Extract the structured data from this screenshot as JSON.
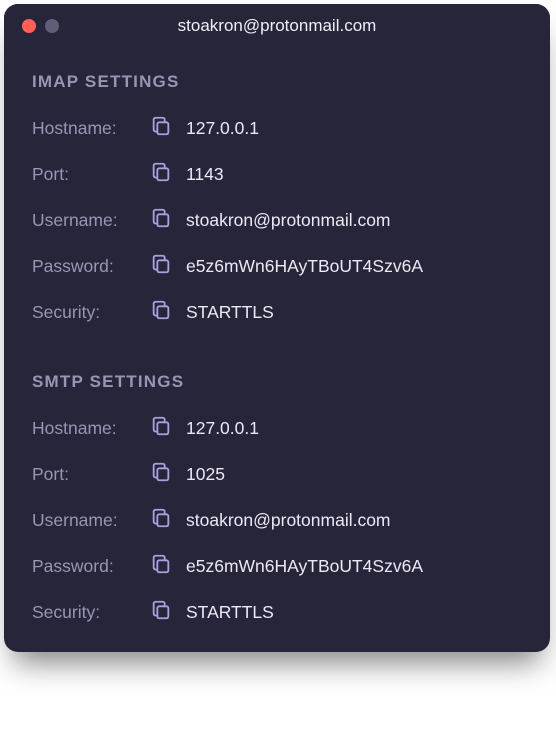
{
  "titlebar": {
    "title": "stoakron@protonmail.com"
  },
  "sections": [
    {
      "heading": "IMAP SETTINGS",
      "rows": [
        {
          "label": "Hostname:",
          "value": "127.0.0.1"
        },
        {
          "label": "Port:",
          "value": "1143"
        },
        {
          "label": "Username:",
          "value": "stoakron@protonmail.com"
        },
        {
          "label": "Password:",
          "value": "e5z6mWn6HAyTBoUT4Szv6A"
        },
        {
          "label": "Security:",
          "value": "STARTTLS"
        }
      ]
    },
    {
      "heading": "SMTP SETTINGS",
      "rows": [
        {
          "label": "Hostname:",
          "value": "127.0.0.1"
        },
        {
          "label": "Port:",
          "value": "1025"
        },
        {
          "label": "Username:",
          "value": "stoakron@protonmail.com"
        },
        {
          "label": "Password:",
          "value": "e5z6mWn6HAyTBoUT4Szv6A"
        },
        {
          "label": "Security:",
          "value": "STARTTLS"
        }
      ]
    }
  ],
  "colors": {
    "bg": "#27253a",
    "muted": "#9a95b5",
    "text": "#ece9f5",
    "iconStroke": "#a9a0e0"
  }
}
